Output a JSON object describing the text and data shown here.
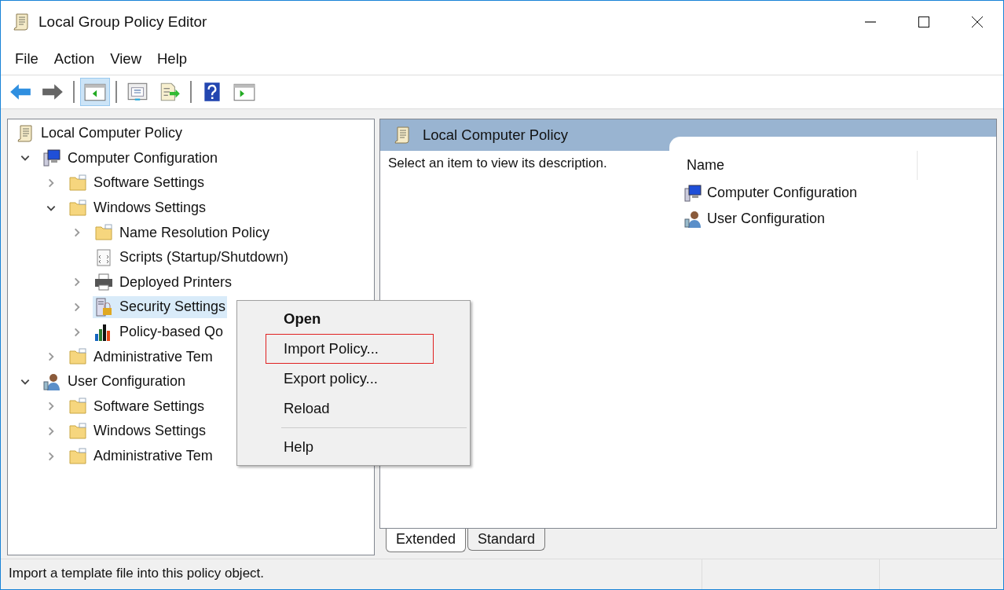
{
  "window": {
    "title": "Local Group Policy Editor"
  },
  "menu_bar": [
    "File",
    "Action",
    "View",
    "Help"
  ],
  "toolbar": [
    [
      {
        "kind": "back",
        "pressed": false
      },
      {
        "kind": "forward",
        "pressed": false
      }
    ],
    [
      {
        "kind": "tree",
        "pressed": true
      }
    ],
    [
      {
        "kind": "properties",
        "pressed": false
      },
      {
        "kind": "export",
        "pressed": false
      }
    ],
    [
      {
        "kind": "help",
        "pressed": false
      },
      {
        "kind": "actionpane",
        "pressed": false
      }
    ]
  ],
  "tree": [
    {
      "label": "Local Computer Policy",
      "kind": "policy",
      "selected": false,
      "children": [
        {
          "label": "Computer Configuration",
          "kind": "computer",
          "expanded": true,
          "selected": false,
          "children": [
            {
              "label": "Software Settings",
              "kind": "folder",
              "expanded": false,
              "selected": false
            },
            {
              "label": "Windows Settings",
              "kind": "folder",
              "expanded": true,
              "selected": false,
              "children": [
                {
                  "label": "Name Resolution Policy",
                  "kind": "folder",
                  "expanded": false,
                  "selected": false
                },
                {
                  "label": "Scripts (Startup/Shutdown)",
                  "kind": "script",
                  "selected": false
                },
                {
                  "label": "Deployed Printers",
                  "kind": "printer",
                  "expanded": false,
                  "selected": false
                },
                {
                  "label": "Security Settings",
                  "kind": "security",
                  "expanded": false,
                  "selected": true
                },
                {
                  "label": "Policy-based Qo",
                  "kind": "chart",
                  "expanded": false,
                  "selected": false
                }
              ]
            },
            {
              "label": "Administrative Tem",
              "kind": "folder",
              "expanded": false,
              "selected": false
            }
          ]
        },
        {
          "label": "User Configuration",
          "kind": "user",
          "expanded": true,
          "selected": false,
          "children": [
            {
              "label": "Software Settings",
              "kind": "folder",
              "expanded": false,
              "selected": false
            },
            {
              "label": "Windows Settings",
              "kind": "folder",
              "expanded": false,
              "selected": false
            },
            {
              "label": "Administrative Tem",
              "kind": "folder",
              "expanded": false,
              "selected": false
            }
          ]
        }
      ]
    }
  ],
  "context_menu": [
    [
      {
        "label": "Open",
        "default": true,
        "highlighted": false
      },
      {
        "label": "Import Policy...",
        "default": false,
        "highlighted": true
      },
      {
        "label": "Export policy...",
        "default": false,
        "highlighted": false
      },
      {
        "label": "Reload",
        "default": false,
        "highlighted": false
      }
    ],
    [
      {
        "label": "Help",
        "default": false,
        "highlighted": false
      }
    ]
  ],
  "details": {
    "title": "Local Computer Policy",
    "description": "Select an item to view its description.",
    "column": "Name",
    "items": [
      {
        "label": "Computer Configuration",
        "kind": "computer"
      },
      {
        "label": "User Configuration",
        "kind": "user"
      }
    ]
  },
  "tabs": [
    {
      "label": "Extended",
      "selected": true
    },
    {
      "label": "Standard",
      "selected": false
    }
  ],
  "status_bar": "Import a template file into this policy object."
}
